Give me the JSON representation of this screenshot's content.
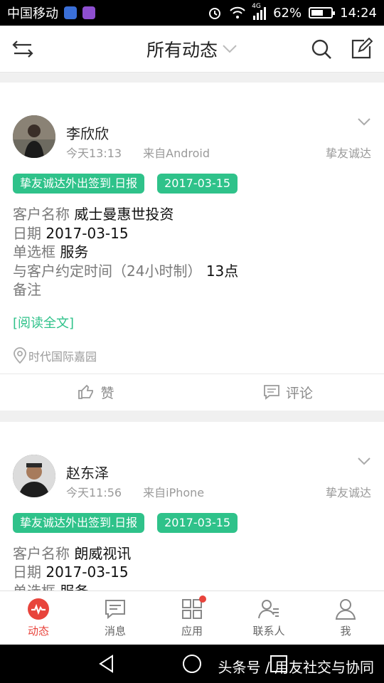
{
  "status_bar": {
    "carrier": "中国移动",
    "network": "4G",
    "battery": "62%",
    "battery_level": 0.62,
    "time": "14:24"
  },
  "header": {
    "title": "所有动态",
    "icons": [
      "collapse-arrows-icon",
      "chevron-down-icon",
      "search-icon",
      "edit-icon"
    ]
  },
  "posts": [
    {
      "author": "李欣欣",
      "time": "今天13:13",
      "source": "来自Android",
      "company": "挚友诚达",
      "tags": [
        "挚友诚达外出签到.日报",
        "2017-03-15"
      ],
      "fields": [
        {
          "label": "客户名称",
          "value": "威士曼惠世投资"
        },
        {
          "label": "日期",
          "value": "2017-03-15"
        },
        {
          "label": "单选框",
          "value": "服务"
        },
        {
          "label": "与客户约定时间（24小时制）",
          "value": "13点"
        },
        {
          "label": "备注",
          "value": ""
        }
      ],
      "read_more": "[阅读全文]",
      "location": "时代国际嘉园",
      "like_label": "赞",
      "comment_label": "评论"
    },
    {
      "author": "赵东泽",
      "time": "今天11:56",
      "source": "来自iPhone",
      "company": "挚友诚达",
      "tags": [
        "挚友诚达外出签到.日报",
        "2017-03-15"
      ],
      "fields": [
        {
          "label": "客户名称",
          "value": "朗威视讯"
        },
        {
          "label": "日期",
          "value": "2017-03-15"
        },
        {
          "label": "单选框",
          "value": "服务"
        }
      ]
    }
  ],
  "tabbar": {
    "items": [
      {
        "label": "动态",
        "icon": "activity-icon",
        "active": true
      },
      {
        "label": "消息",
        "icon": "message-icon"
      },
      {
        "label": "应用",
        "icon": "apps-grid-icon",
        "badge": true
      },
      {
        "label": "联系人",
        "icon": "contacts-icon"
      },
      {
        "label": "我",
        "icon": "profile-icon"
      }
    ]
  },
  "watermark": "头条号 / 用友社交与协同",
  "colors": {
    "accent_green": "#2fc28a",
    "active_red": "#e8443c"
  }
}
